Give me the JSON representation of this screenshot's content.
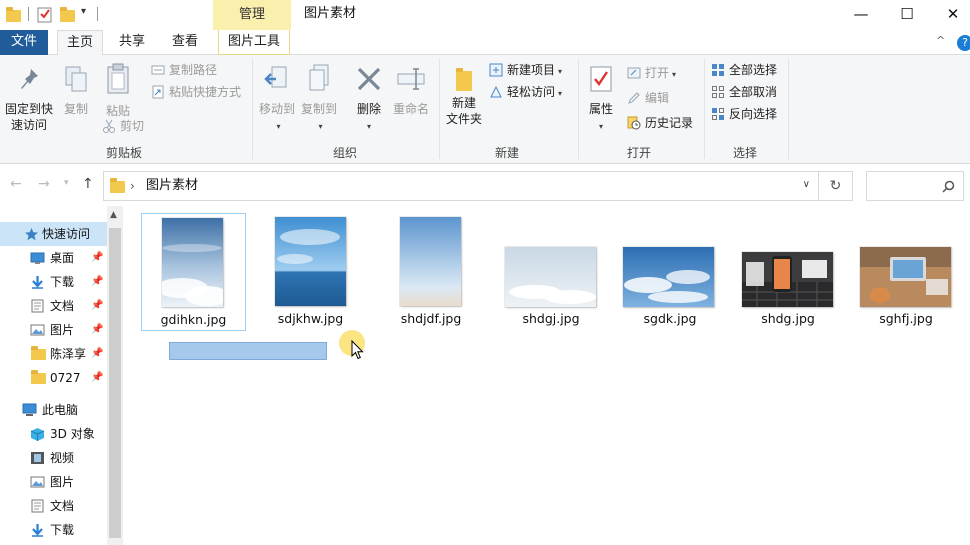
{
  "window": {
    "manage_tab": "管理",
    "title": "图片素材",
    "minimize": "—",
    "maximize": "☐",
    "close": "✕"
  },
  "tabs": {
    "file": "文件",
    "home": "主页",
    "share": "共享",
    "view": "查看",
    "picture_tools": "图片工具",
    "collapse": "^",
    "help": "?"
  },
  "ribbon": {
    "clipboard": {
      "label": "剪贴板",
      "pin_quick_access": [
        "固定到快",
        "速访问"
      ],
      "copy": "复制",
      "paste": "粘贴",
      "copy_path": "复制路径",
      "paste_shortcut": "粘贴快捷方式",
      "cut": "剪切"
    },
    "organize": {
      "label": "组织",
      "move_to": "移动到",
      "copy_to": "复制到",
      "delete": "删除",
      "rename": "重命名"
    },
    "new": {
      "label": "新建",
      "new_folder": [
        "新建",
        "文件夹"
      ],
      "new_item": "新建项目",
      "easy_access": "轻松访问"
    },
    "open": {
      "label": "打开",
      "properties": "属性",
      "open": "打开",
      "edit": "编辑",
      "history": "历史记录"
    },
    "select": {
      "label": "选择",
      "select_all": "全部选择",
      "select_none": "全部取消",
      "invert": "反向选择"
    }
  },
  "address": {
    "path": "图片素材",
    "sep": "›"
  },
  "nav": {
    "quick_access": "快速访问",
    "quick_items": [
      {
        "label": "桌面"
      },
      {
        "label": "下载"
      },
      {
        "label": "文档"
      },
      {
        "label": "图片"
      },
      {
        "label": "陈泽享"
      },
      {
        "label": "0727"
      }
    ],
    "this_pc": "此电脑",
    "pc_items": [
      {
        "label": "3D 对象"
      },
      {
        "label": "视频"
      },
      {
        "label": "图片"
      },
      {
        "label": "文档"
      },
      {
        "label": "下载"
      }
    ]
  },
  "files": [
    {
      "name": "gdihkn.jpg",
      "selected": true
    },
    {
      "name": "sdjkhw.jpg",
      "selected": false
    },
    {
      "name": "shdjdf.jpg",
      "selected": false
    },
    {
      "name": "shdgj.jpg",
      "selected": false
    },
    {
      "name": "sgdk.jpg",
      "selected": false
    },
    {
      "name": "shdg.jpg",
      "selected": false
    },
    {
      "name": "sghfj.jpg",
      "selected": false
    }
  ],
  "colors": {
    "accent": "#1f5c99",
    "manage_tab_bg": "#fbefad",
    "selection_bg": "#cce4f7",
    "rename_box": "#a6c8ec",
    "folder": "#f2c94c"
  }
}
